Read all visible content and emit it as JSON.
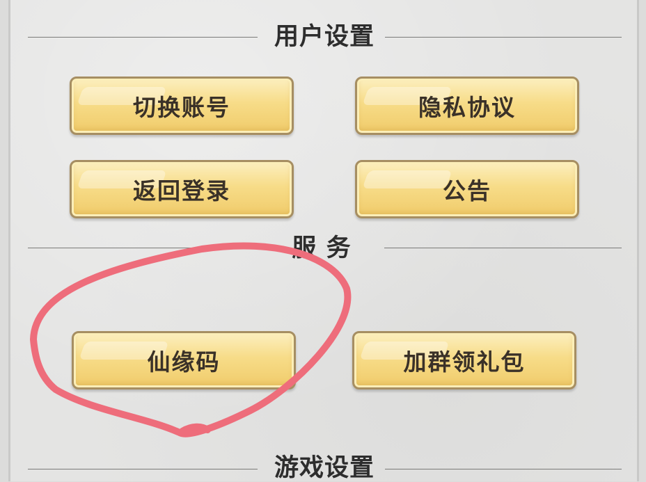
{
  "sections": {
    "user_settings": {
      "title": "用户设置"
    },
    "services": {
      "title": "服 务"
    },
    "game_settings": {
      "title": "游戏设置"
    }
  },
  "buttons": {
    "switch_account": "切换账号",
    "privacy_policy": "隐私协议",
    "back_to_login": "返回登录",
    "announcement": "公告",
    "xianyuan_code": "仙缘码",
    "join_group_gift": "加群领礼包"
  },
  "colors": {
    "button_fill": "#f7dc88",
    "button_border": "#a68e62",
    "annotation": "#ee6d7b"
  }
}
